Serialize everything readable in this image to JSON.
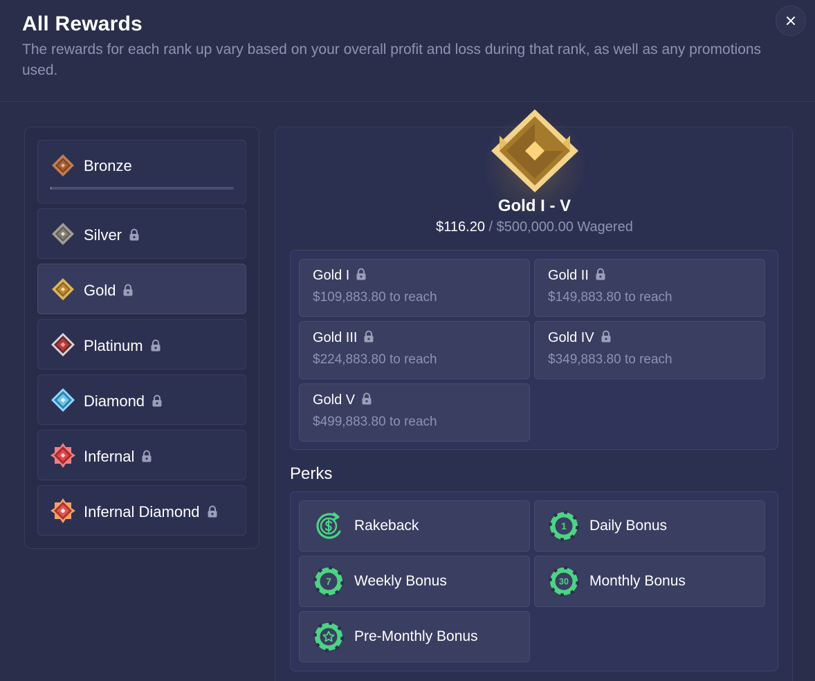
{
  "header": {
    "title": "All Rewards",
    "subtitle": "The rewards for each rank up vary based on your overall profit and loss during that rank, as well as any promotions used."
  },
  "close_icon": "close-icon",
  "ranks": [
    {
      "label": "Bronze",
      "icon": "bronze-rank-icon",
      "locked": false,
      "progress": 0.0
    },
    {
      "label": "Silver",
      "icon": "silver-rank-icon",
      "locked": true
    },
    {
      "label": "Gold",
      "icon": "gold-rank-icon",
      "locked": true,
      "selected": true
    },
    {
      "label": "Platinum",
      "icon": "platinum-rank-icon",
      "locked": true
    },
    {
      "label": "Diamond",
      "icon": "diamond-rank-icon",
      "locked": true
    },
    {
      "label": "Infernal",
      "icon": "infernal-rank-icon",
      "locked": true
    },
    {
      "label": "Infernal Diamond",
      "icon": "infernal-diamond-rank-icon",
      "locked": true
    }
  ],
  "detail": {
    "rank_title": "Gold I - V",
    "wagered_current": "$116.20",
    "wagered_separator": " / ",
    "wagered_target": "$500,000.00 Wagered",
    "tiers": [
      {
        "name": "Gold I",
        "reach_amount": "$109,883.80",
        "reach_suffix": " to reach"
      },
      {
        "name": "Gold II",
        "reach_amount": "$149,883.80",
        "reach_suffix": " to reach"
      },
      {
        "name": "Gold III",
        "reach_amount": "$224,883.80",
        "reach_suffix": " to reach"
      },
      {
        "name": "Gold IV",
        "reach_amount": "$349,883.80",
        "reach_suffix": " to reach"
      },
      {
        "name": "Gold V",
        "reach_amount": "$499,883.80",
        "reach_suffix": " to reach"
      }
    ],
    "perks_title": "Perks",
    "perks": [
      {
        "label": "Rakeback",
        "icon": "rakeback-icon"
      },
      {
        "label": "Daily Bonus",
        "icon": "daily-bonus-chip-icon",
        "chip_text": "1"
      },
      {
        "label": "Weekly Bonus",
        "icon": "weekly-bonus-chip-icon",
        "chip_text": "7"
      },
      {
        "label": "Monthly Bonus",
        "icon": "monthly-bonus-chip-icon",
        "chip_text": "30"
      },
      {
        "label": "Pre-Monthly Bonus",
        "icon": "pre-monthly-bonus-chip-icon"
      }
    ]
  },
  "colors": {
    "background": "#2a2e4b",
    "muted_text": "#8e93b3",
    "perk_green": "#4cd483",
    "gold": "#d4a53c",
    "bronze": "#c47c4c",
    "silver": "#9a948c",
    "platinum": "#b23b3b",
    "diamond": "#6fc4ee",
    "infernal": "#e0454a"
  }
}
